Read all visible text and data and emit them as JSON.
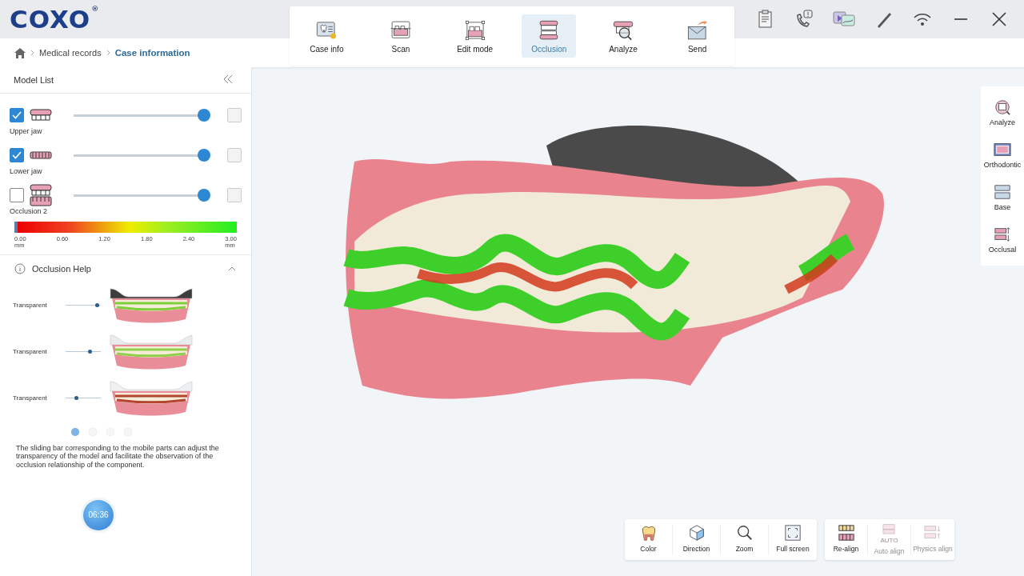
{
  "logo": {
    "text": "COXO",
    "mark": "®"
  },
  "breadcrumb": [
    {
      "label": "Medical records",
      "selected": false
    },
    {
      "label": "Case information",
      "selected": true
    }
  ],
  "steps": [
    {
      "label": "Case info",
      "kind": "card",
      "selected": false
    },
    {
      "label": "Scan",
      "kind": "scan",
      "selected": false
    },
    {
      "label": "Edit mode",
      "kind": "edit",
      "selected": false
    },
    {
      "label": "Occlusion",
      "kind": "jaws",
      "selected": true
    },
    {
      "label": "Analyze",
      "kind": "analyze",
      "selected": false
    },
    {
      "label": "Send",
      "kind": "send",
      "selected": false
    }
  ],
  "model_list": {
    "title": "Model List",
    "items": [
      {
        "name": "Upper jaw",
        "kind": "upper",
        "checked": true,
        "level": 0.95
      },
      {
        "name": "Lower jaw",
        "kind": "lower",
        "checked": true,
        "level": 0.95
      },
      {
        "name": "Occlusion 2",
        "kind": "both",
        "checked": false,
        "level": 0.95
      }
    ],
    "legend": [
      {
        "value": "0.00",
        "unit": "mm"
      },
      {
        "value": "0.60"
      },
      {
        "value": "1.20"
      },
      {
        "value": "1.80"
      },
      {
        "value": "2.40"
      },
      {
        "value": "3.00",
        "unit": "mm"
      }
    ]
  },
  "help": {
    "title": "Occlusion Help",
    "expanded": true,
    "examples": [
      {
        "label": "Transparent",
        "level": 0.9,
        "kind": "dark"
      },
      {
        "label": "Transparent",
        "level": 0.7,
        "kind": "clear"
      },
      {
        "label": "Transparent",
        "level": 0.3,
        "kind": "red"
      }
    ],
    "dots": [
      {
        "selected": true
      },
      {
        "selected": false
      },
      {
        "selected": false
      },
      {
        "selected": false
      }
    ],
    "text": "The sliding bar corresponding to the mobile parts can adjust the transparency of the model and facilitate the observation of the occlusion relationship of the component."
  },
  "timer": "06:36",
  "side_tools": [
    {
      "label": "Analyze",
      "kind": "analyze"
    },
    {
      "label": "Orthodontic",
      "kind": "ortho"
    },
    {
      "label": "Base",
      "kind": "base"
    },
    {
      "label": "Occlusal",
      "kind": "occlusal"
    }
  ],
  "view_tools": [
    {
      "label": "Color",
      "kind": "tooth",
      "disabled": false
    },
    {
      "label": "Direction",
      "kind": "cube",
      "disabled": false
    },
    {
      "label": "Zoom",
      "kind": "zoom",
      "disabled": false
    },
    {
      "label": "Full screen",
      "kind": "full",
      "disabled": false
    }
  ],
  "align_tools": [
    {
      "label": "Re-align",
      "kind": "realign",
      "disabled": false
    },
    {
      "label": "Auto align",
      "kind": "auto",
      "badge": "AUTO",
      "disabled": true
    },
    {
      "label": "Physics align",
      "kind": "physics",
      "disabled": true
    }
  ]
}
